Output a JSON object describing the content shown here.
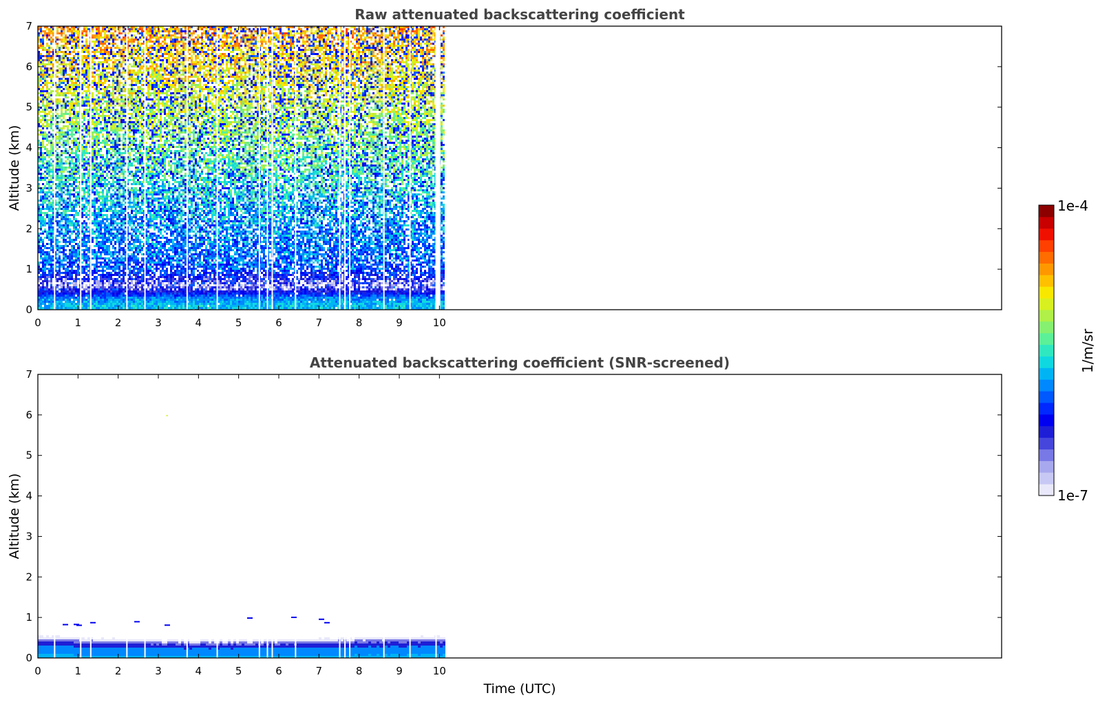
{
  "chart_data": [
    {
      "type": "heatmap",
      "title": "Raw attenuated backscattering coefficient",
      "xlabel": "",
      "ylabel": "Altitude (km)",
      "xlim": [
        0,
        24
      ],
      "ylim": [
        0,
        7
      ],
      "x_ticks": [
        "0",
        "1",
        "2",
        "3",
        "4",
        "5",
        "6",
        "7",
        "8",
        "9",
        "10"
      ],
      "y_ticks": [
        "0",
        "1",
        "2",
        "3",
        "4",
        "5",
        "6",
        "7"
      ],
      "data_extent_hours": [
        0,
        10.1
      ],
      "data_gaps_hours": [
        0.4,
        1.05,
        1.3,
        2.2,
        2.65,
        3.7,
        4.45,
        5.5,
        5.7,
        5.82,
        6.4,
        7.5,
        7.63,
        7.75,
        8.6,
        9.25,
        9.9
      ],
      "profile": [
        {
          "alt_km": 0.1,
          "value": 2e-06
        },
        {
          "alt_km": 0.3,
          "value": 1.3e-06
        },
        {
          "alt_km": 0.6,
          "value": 2e-07
        },
        {
          "alt_km": 1.0,
          "value": 1.2e-06
        },
        {
          "alt_km": 2.0,
          "value": 1.8e-06
        },
        {
          "alt_km": 3.0,
          "value": 3e-06
        },
        {
          "alt_km": 4.0,
          "value": 5e-06
        },
        {
          "alt_km": 5.0,
          "value": 8e-06
        },
        {
          "alt_km": 6.0,
          "value": 1.3e-05
        },
        {
          "alt_km": 7.0,
          "value": 2e-05
        }
      ]
    },
    {
      "type": "heatmap",
      "title": "Attenuated backscattering coefficient (SNR-screened)",
      "xlabel": "Time (UTC)",
      "ylabel": "Altitude (km)",
      "xlim": [
        0,
        24
      ],
      "ylim": [
        0,
        7
      ],
      "x_ticks": [
        "0",
        "1",
        "2",
        "3",
        "4",
        "5",
        "6",
        "7",
        "8",
        "9",
        "10"
      ],
      "y_ticks": [
        "0",
        "1",
        "2",
        "3",
        "4",
        "5",
        "6",
        "7"
      ],
      "data_extent_hours": [
        0,
        10.1
      ],
      "profile": [
        {
          "alt_km": 0.1,
          "value": 2e-06
        },
        {
          "alt_km": 0.2,
          "value": 1.5e-06
        },
        {
          "alt_km": 0.35,
          "value": 5e-07
        },
        {
          "alt_km": 0.5,
          "value": 2e-07
        },
        {
          "alt_km": 0.9,
          "value": 1.2e-06
        }
      ]
    }
  ],
  "colorbar": {
    "label": "1/m/sr",
    "min_label": "1e-7",
    "max_label": "1e-4",
    "scale": "log",
    "colors": [
      "#e8e8fa",
      "#c8c8f4",
      "#a8a8ee",
      "#7878e6",
      "#4646dc",
      "#1e1ed6",
      "#0000f0",
      "#0028ff",
      "#0058ff",
      "#0088ff",
      "#00b4f4",
      "#10d8e0",
      "#30e8c0",
      "#5cf098",
      "#86f070",
      "#b0f048",
      "#d8f020",
      "#f8e800",
      "#ffc000",
      "#ff9800",
      "#ff6c00",
      "#ff4000",
      "#f01000",
      "#c80000",
      "#8c0000"
    ]
  }
}
